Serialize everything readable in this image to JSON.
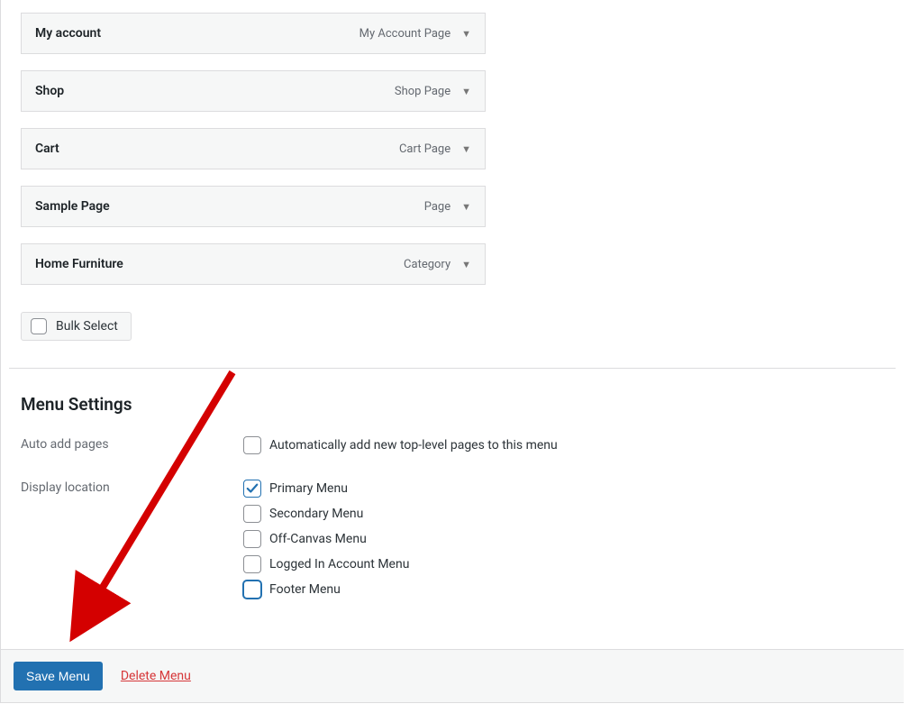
{
  "menu_items": [
    {
      "title": "My account",
      "type": "My Account Page"
    },
    {
      "title": "Shop",
      "type": "Shop Page"
    },
    {
      "title": "Cart",
      "type": "Cart Page"
    },
    {
      "title": "Sample Page",
      "type": "Page"
    },
    {
      "title": "Home Furniture",
      "type": "Category"
    }
  ],
  "bulk_select_label": "Bulk Select",
  "settings": {
    "heading": "Menu Settings",
    "auto_add": {
      "label": "Auto add pages",
      "option": "Automatically add new top-level pages to this menu",
      "checked": false
    },
    "display_location": {
      "label": "Display location",
      "options": [
        {
          "label": "Primary Menu",
          "checked": true,
          "focused": false
        },
        {
          "label": "Secondary Menu",
          "checked": false,
          "focused": false
        },
        {
          "label": "Off-Canvas Menu",
          "checked": false,
          "focused": false
        },
        {
          "label": "Logged In Account Menu",
          "checked": false,
          "focused": false
        },
        {
          "label": "Footer Menu",
          "checked": false,
          "focused": true
        }
      ]
    }
  },
  "actions": {
    "save": "Save Menu",
    "delete": "Delete Menu"
  }
}
